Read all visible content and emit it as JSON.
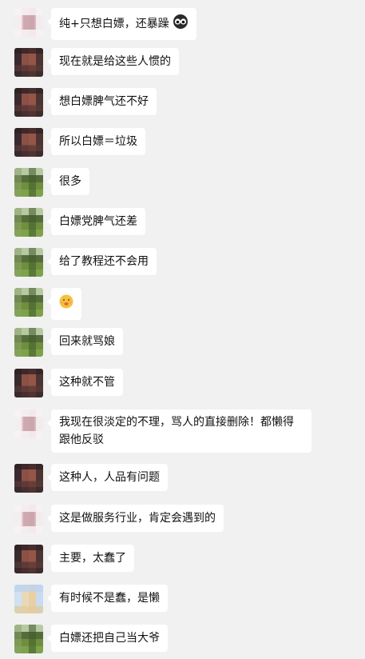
{
  "messages": [
    {
      "avatar": "pink",
      "text": "纯+只想白嫖，还暴躁",
      "emoji": "owl-eyes-icon"
    },
    {
      "avatar": "dark",
      "text": "现在就是给这些人惯的"
    },
    {
      "avatar": "dark",
      "text": "想白嫖脾气还不好"
    },
    {
      "avatar": "dark",
      "text": "所以白嫖＝垃圾"
    },
    {
      "avatar": "green",
      "text": "很多"
    },
    {
      "avatar": "green",
      "text": "白嫖党脾气还差"
    },
    {
      "avatar": "green",
      "text": "给了教程还不会用"
    },
    {
      "avatar": "green",
      "text": "",
      "emoji": "zipper-mouth-face-icon"
    },
    {
      "avatar": "green",
      "text": "回来就骂娘"
    },
    {
      "avatar": "dark",
      "text": "这种就不管"
    },
    {
      "avatar": "pink",
      "text": "我现在很淡定的不理，骂人的直接删除！都懒得跟他反驳"
    },
    {
      "avatar": "dark",
      "text": "这种人，人品有问题"
    },
    {
      "avatar": "pink",
      "text": "这是做服务行业，肯定会遇到的"
    },
    {
      "avatar": "dark",
      "text": "主要，太蠢了"
    },
    {
      "avatar": "blue",
      "text": "有时候不是蠢，是懒"
    },
    {
      "avatar": "green",
      "text": "白嫖还把自己当大爷"
    }
  ],
  "colors": {
    "background": "#f1f1f1",
    "bubble": "#ffffff"
  }
}
